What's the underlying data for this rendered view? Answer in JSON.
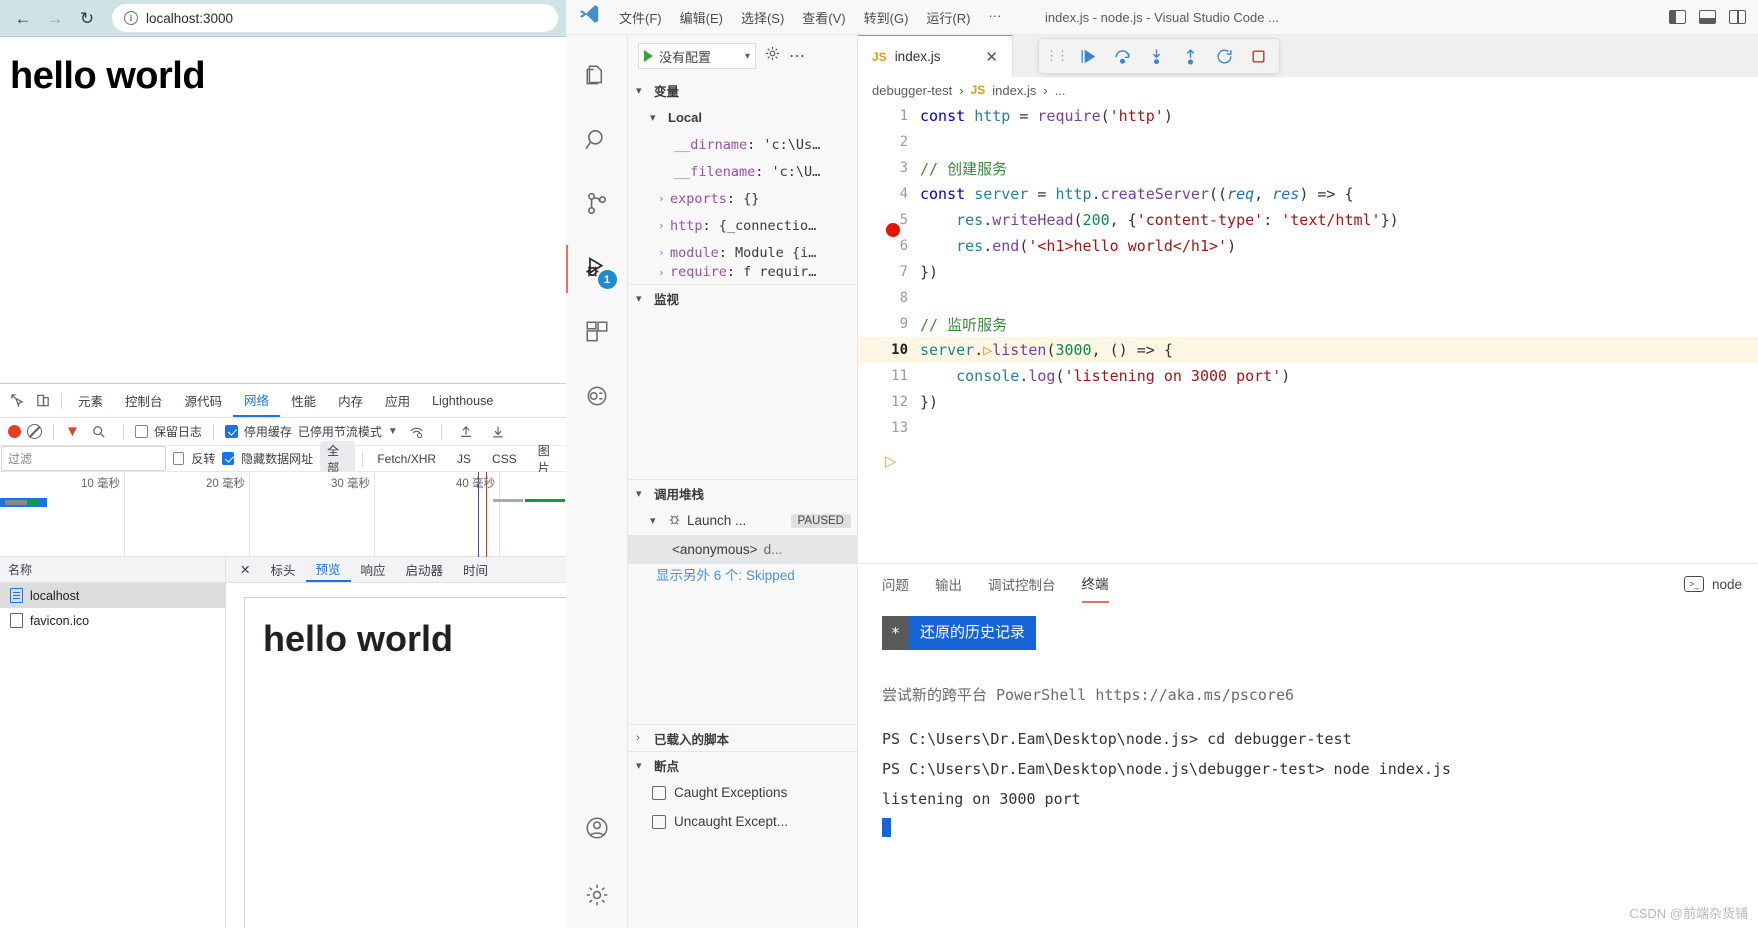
{
  "browser": {
    "nav": {
      "back": "←",
      "forward": "→",
      "reload": "↻"
    },
    "omnibox": {
      "value": "localhost:3000",
      "info_icon": "i"
    },
    "page": {
      "heading": "hello world"
    }
  },
  "devtools": {
    "tabs": [
      {
        "label": "元素",
        "active": false
      },
      {
        "label": "控制台",
        "active": false
      },
      {
        "label": "源代码",
        "active": false
      },
      {
        "label": "网络",
        "active": true
      },
      {
        "label": "性能",
        "active": false
      },
      {
        "label": "内存",
        "active": false
      },
      {
        "label": "应用",
        "active": false
      },
      {
        "label": "Lighthouse",
        "active": false
      }
    ],
    "toolbar": {
      "preserve_log": "保留日志",
      "preserve_log_checked": false,
      "disable_cache": "停用缓存",
      "disable_cache_checked": true,
      "throttling": "已停用节流模式"
    },
    "filterbar": {
      "filter_placeholder": "过滤",
      "invert": "反转",
      "invert_checked": false,
      "hide_data_urls": "隐藏数据网址",
      "hide_data_urls_checked": true,
      "types": [
        "全部",
        "Fetch/XHR",
        "JS",
        "CSS",
        "图片"
      ],
      "selected_type": "全部"
    },
    "overview_ticks": [
      "10 毫秒",
      "20 毫秒",
      "30 毫秒",
      "40 毫秒"
    ],
    "requests_header": "名称",
    "requests": [
      {
        "name": "localhost",
        "icon": "document-icon",
        "selected": true
      },
      {
        "name": "favicon.ico",
        "icon": "blank-icon",
        "selected": false
      }
    ],
    "detail_tabs": [
      {
        "label": "标头",
        "active": false
      },
      {
        "label": "预览",
        "active": true
      },
      {
        "label": "响应",
        "active": false
      },
      {
        "label": "启动器",
        "active": false
      },
      {
        "label": "时间",
        "active": false
      }
    ],
    "preview_heading": "hello world"
  },
  "vscode": {
    "title": "index.js - node.js - Visual Studio Code ...",
    "menu": [
      "文件(F)",
      "编辑(E)",
      "选择(S)",
      "查看(V)",
      "转到(G)",
      "运行(R)",
      "···"
    ],
    "activity_items": [
      {
        "name": "explorer",
        "glyph": "files-icon"
      },
      {
        "name": "search",
        "glyph": "search-icon"
      },
      {
        "name": "source-control",
        "glyph": "branch-icon"
      },
      {
        "name": "run-and-debug",
        "glyph": "debug-icon",
        "badge": "1",
        "active": true
      },
      {
        "name": "extensions",
        "glyph": "extensions-icon"
      },
      {
        "name": "remote",
        "glyph": "remote-icon"
      },
      {
        "name": "accounts",
        "glyph": "account-icon"
      },
      {
        "name": "settings",
        "glyph": "gear-icon"
      }
    ],
    "debug": {
      "launch_config": "没有配置",
      "sections": {
        "variables": "变量",
        "watch": "监视",
        "call_stack": "调用堆栈",
        "loaded_scripts": "已载入的脚本",
        "breakpoints": "断点"
      },
      "scope": "Local",
      "variables": [
        {
          "key": "__dirname",
          "value": "'c:\\Us…",
          "expandable": false
        },
        {
          "key": "__filename",
          "value": "'c:\\U…",
          "expandable": false
        },
        {
          "key": "exports",
          "value": "{}",
          "expandable": true
        },
        {
          "key": "http",
          "value": "{_connectio…",
          "expandable": true
        },
        {
          "key": "module",
          "value": "Module {i…",
          "expandable": true
        },
        {
          "key": "require",
          "value": "f requir…",
          "expandable": true
        }
      ],
      "call_stack": [
        {
          "label": "Launch ...",
          "badge": "PAUSED",
          "type": "session"
        },
        {
          "label": "<anonymous>",
          "detail": "d...",
          "type": "frame",
          "selected": true
        }
      ],
      "skipped_text": "显示另外 6 个: Skipped",
      "breakpoints": [
        {
          "label": "Caught Exceptions",
          "checked": false
        },
        {
          "label": "Uncaught Except...",
          "checked": false
        }
      ]
    },
    "editor": {
      "tab": {
        "label": "index.js",
        "badge": "JS"
      },
      "breadcrumb": [
        "debugger-test",
        "index.js",
        "..."
      ],
      "breadcrumb_badge": "JS",
      "debug_toolbar": [
        "continue",
        "step-over",
        "step-into",
        "step-out",
        "restart",
        "stop"
      ],
      "code": [
        {
          "num": "1",
          "bp": "dot",
          "tokens": [
            [
              "k",
              "const"
            ],
            [
              "pl",
              " "
            ],
            [
              "var",
              "http"
            ],
            [
              "pl",
              " = "
            ],
            [
              "fn",
              "require"
            ],
            [
              "pl",
              "("
            ],
            [
              "str",
              "'http'"
            ],
            [
              "pl",
              ")"
            ]
          ]
        },
        {
          "num": "2",
          "tokens": []
        },
        {
          "num": "3",
          "tokens": [
            [
              "cmt",
              "// 创建服务"
            ]
          ]
        },
        {
          "num": "4",
          "tokens": [
            [
              "k",
              "const"
            ],
            [
              "pl",
              " "
            ],
            [
              "var",
              "server"
            ],
            [
              "pl",
              " = "
            ],
            [
              "var",
              "http"
            ],
            [
              "pl",
              "."
            ],
            [
              "fn",
              "createServer"
            ],
            [
              "pl",
              "(("
            ],
            [
              "param",
              "req"
            ],
            [
              "pl",
              ", "
            ],
            [
              "param",
              "res"
            ],
            [
              "pl",
              ") => {"
            ]
          ]
        },
        {
          "num": "5",
          "tokens": [
            [
              "pl",
              "    "
            ],
            [
              "var",
              "res"
            ],
            [
              "pl",
              "."
            ],
            [
              "fn",
              "writeHead"
            ],
            [
              "pl",
              "("
            ],
            [
              "num",
              "200"
            ],
            [
              "pl",
              ", {"
            ],
            [
              "str",
              "'content-type'"
            ],
            [
              "pl",
              ": "
            ],
            [
              "str",
              "'text/html'"
            ],
            [
              "pl",
              "})"
            ]
          ]
        },
        {
          "num": "6",
          "tokens": [
            [
              "pl",
              "    "
            ],
            [
              "var",
              "res"
            ],
            [
              "pl",
              "."
            ],
            [
              "fn",
              "end"
            ],
            [
              "pl",
              "("
            ],
            [
              "str",
              "'<h1>hello world</h1>'"
            ],
            [
              "pl",
              ")"
            ]
          ]
        },
        {
          "num": "7",
          "tokens": [
            [
              "pl",
              "})"
            ]
          ]
        },
        {
          "num": "8",
          "tokens": []
        },
        {
          "num": "9",
          "tokens": [
            [
              "cmt",
              "// 监听服务"
            ]
          ]
        },
        {
          "num": "10",
          "bp": "arrow",
          "hl": true,
          "tokens": [
            [
              "var",
              "server"
            ],
            [
              "pl",
              "."
            ],
            [
              "inline-bp",
              "▷"
            ],
            [
              "fn",
              "listen"
            ],
            [
              "pl",
              "("
            ],
            [
              "num",
              "3000"
            ],
            [
              "pl",
              ", () => {"
            ]
          ]
        },
        {
          "num": "11",
          "tokens": [
            [
              "pl",
              "    "
            ],
            [
              "var",
              "console"
            ],
            [
              "pl",
              "."
            ],
            [
              "fn",
              "log"
            ],
            [
              "pl",
              "("
            ],
            [
              "str",
              "'listening on 3000 port'"
            ],
            [
              "pl",
              ")"
            ]
          ]
        },
        {
          "num": "12",
          "tokens": [
            [
              "pl",
              "})"
            ]
          ]
        },
        {
          "num": "13",
          "tokens": []
        }
      ]
    },
    "panel": {
      "tabs": [
        {
          "label": "问题",
          "active": false
        },
        {
          "label": "输出",
          "active": false
        },
        {
          "label": "调试控制台",
          "active": false
        },
        {
          "label": "终端",
          "active": true
        }
      ],
      "shell_label": "node",
      "terminal": {
        "history_star": "*",
        "history_text": "还原的历史记录",
        "lines": [
          "尝试新的跨平台 PowerShell https://aka.ms/pscore6",
          "PS C:\\Users\\Dr.Eam\\Desktop\\node.js> cd debugger-test",
          "PS C:\\Users\\Dr.Eam\\Desktop\\node.js\\debugger-test> node index.js",
          "listening on 3000 port"
        ]
      }
    }
  },
  "watermark": "CSDN @前端杂货铺",
  "colors": {
    "chrome_toolbar": "#cfe3e4",
    "accent_blue": "#1a73e8",
    "vscode_accent": "#e8735a",
    "terminal_blue": "#1565d8"
  }
}
